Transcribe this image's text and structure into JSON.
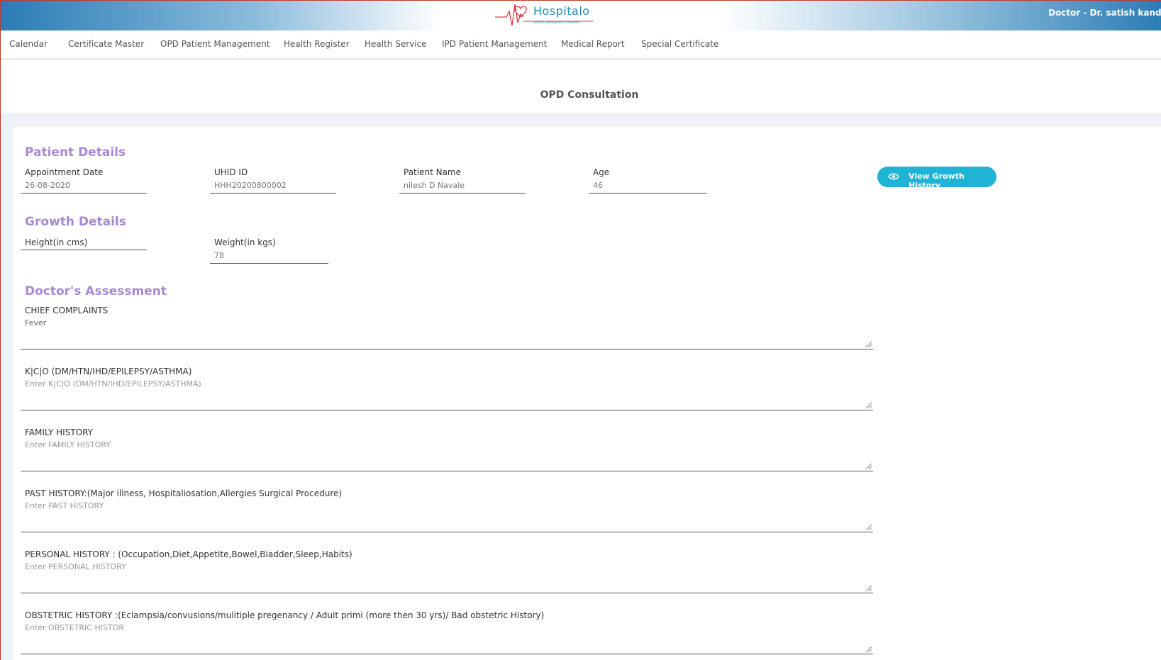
{
  "header": {
    "logo_text": "Hospitalo",
    "logo_subtext": "Hospital Management Simplified",
    "doctor_label": "Doctor - Dr. satish kandregu"
  },
  "nav": {
    "items": [
      {
        "label": "Calendar"
      },
      {
        "label": "Certificate Master"
      },
      {
        "label": "OPD Patient Management"
      },
      {
        "label": "Health Register"
      },
      {
        "label": "Health Service"
      },
      {
        "label": "IPD Patient Management"
      },
      {
        "label": "Medical Report"
      },
      {
        "label": "Special Certificate"
      }
    ]
  },
  "page": {
    "title": "OPD Consultation"
  },
  "patient": {
    "section_title": "Patient Details",
    "appointment_date_label": "Appointment Date",
    "appointment_date": "26-08-2020",
    "uhid_label": "UHID ID",
    "uhid": "HHH20200800002",
    "name_label": "Patient Name",
    "name": "nilesh D Navale",
    "age_label": "Age",
    "age": "46",
    "growth_button": "View Growth History"
  },
  "growth": {
    "section_title": "Growth Details",
    "height_label": "Height(in cms)",
    "height": "",
    "weight_label": "Weight(in kgs)",
    "weight": "78"
  },
  "assessment": {
    "section_title": "Doctor's Assessment",
    "fields": [
      {
        "label": "CHIEF COMPLAINTS",
        "value": "Fever",
        "placeholder": ""
      },
      {
        "label": "K|C|O (DM/HTN/IHD/EPILEPSY/ASTHMA)",
        "value": "",
        "placeholder": "Enter K|C|O (DM/HTN/IHD/EPILEPSY/ASTHMA)"
      },
      {
        "label": "FAMILY HISTORY",
        "value": "",
        "placeholder": "Enter FAMILY HISTORY"
      },
      {
        "label": "PAST HISTORY:(Major illness, Hospitaliosation,Allergies Surgical Procedure)",
        "value": "",
        "placeholder": "Enter PAST HISTORY"
      },
      {
        "label": "PERSONAL HISTORY : (Occupation,Diet,Appetite,Bowel,Biadder,Sleep,Habits)",
        "value": "",
        "placeholder": "Enter PERSONAL HISTORY"
      },
      {
        "label": "OBSTETRIC HISTORY :(Eclampsia/convusions/mulitiple pregenancy / Aduit primi (more then 30 yrs)/ Bad obstetric History)",
        "value": "",
        "placeholder": "Enter OBSTETRIC HISTOR"
      }
    ]
  }
}
